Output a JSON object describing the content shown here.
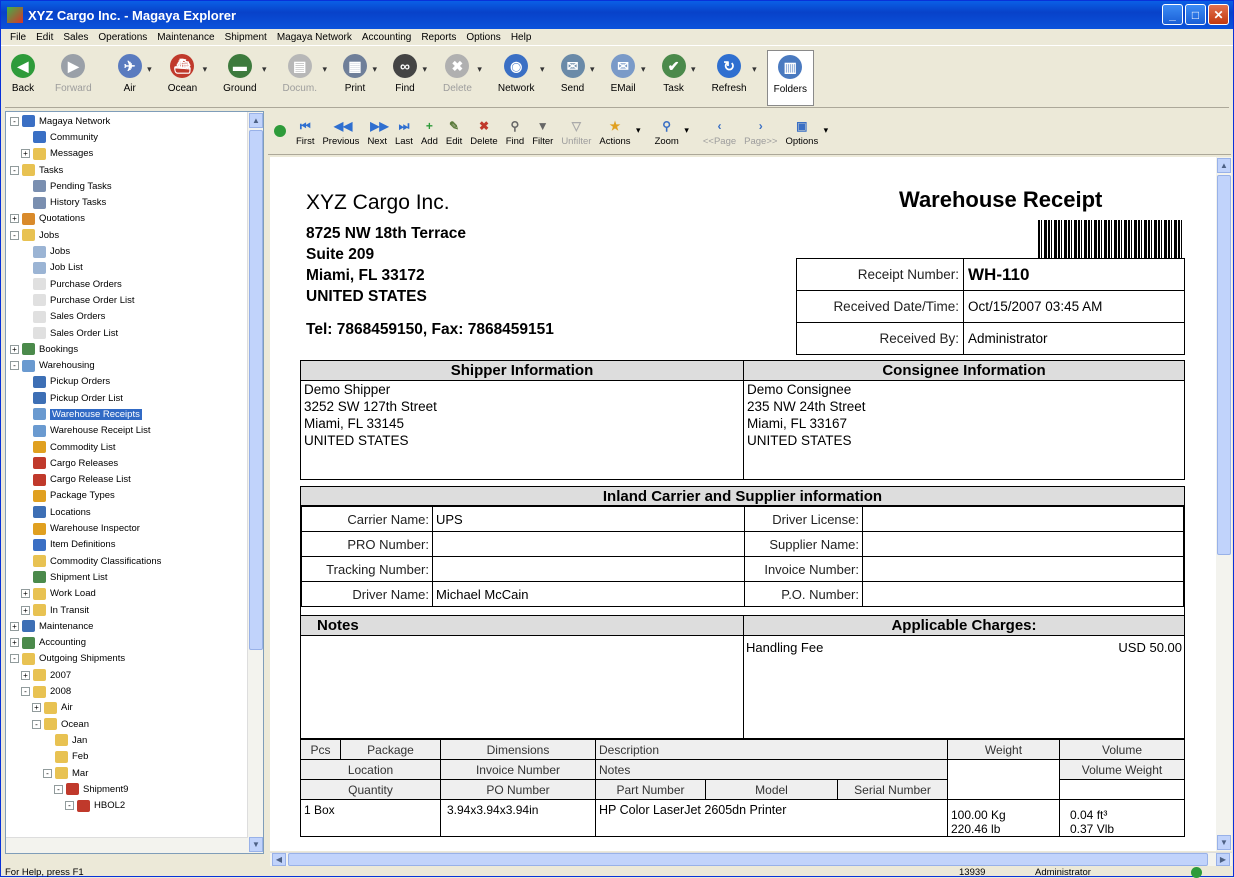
{
  "window": {
    "title": "XYZ Cargo Inc. - Magaya Explorer"
  },
  "menu": [
    "File",
    "Edit",
    "Sales",
    "Operations",
    "Maintenance",
    "Shipment",
    "Magaya Network",
    "Accounting",
    "Reports",
    "Options",
    "Help"
  ],
  "toolbar": [
    {
      "label": "Back",
      "icon": "back-arrow-icon",
      "color": "#2e9b3a",
      "disabled": false
    },
    {
      "label": "Forward",
      "icon": "forward-arrow-icon",
      "color": "#9aa0a8",
      "disabled": true
    },
    {
      "label": "Air",
      "icon": "airplane-icon",
      "color": "#5a7bbf",
      "disabled": false
    },
    {
      "label": "Ocean",
      "icon": "ship-icon",
      "color": "#c0392b",
      "disabled": false
    },
    {
      "label": "Ground",
      "icon": "truck-icon",
      "color": "#3d7a3d",
      "disabled": false
    },
    {
      "label": "Docum.",
      "icon": "document-icon",
      "color": "#b7b7b7",
      "disabled": true
    },
    {
      "label": "Print",
      "icon": "printer-icon",
      "color": "#6f7f99",
      "disabled": false
    },
    {
      "label": "Find",
      "icon": "binoculars-icon",
      "color": "#444",
      "disabled": false
    },
    {
      "label": "Delete",
      "icon": "delete-x-icon",
      "color": "#b0b0b0",
      "disabled": true
    },
    {
      "label": "Network",
      "icon": "network-globe-icon",
      "color": "#3a6fc4",
      "disabled": false
    },
    {
      "label": "Send",
      "icon": "send-icon",
      "color": "#6a8aa8",
      "disabled": false
    },
    {
      "label": "EMail",
      "icon": "email-icon",
      "color": "#7a9ac8",
      "disabled": false
    },
    {
      "label": "Task",
      "icon": "task-icon",
      "color": "#4b8a4b",
      "disabled": false
    },
    {
      "label": "Refresh",
      "icon": "refresh-icon",
      "color": "#2f6fd0",
      "disabled": false
    },
    {
      "label": "Folders",
      "icon": "folders-icon",
      "color": "#4a7ac0",
      "disabled": false
    }
  ],
  "tree": [
    {
      "label": "Magaya Network",
      "level": 0,
      "exp": "-",
      "color": "#3a6fc4"
    },
    {
      "label": "Community",
      "level": 1,
      "exp": "",
      "color": "#3a6fc4"
    },
    {
      "label": "Messages",
      "level": 1,
      "exp": "+",
      "color": "#e8c252"
    },
    {
      "label": "Tasks",
      "level": 0,
      "exp": "-",
      "color": "#e8c252"
    },
    {
      "label": "Pending Tasks",
      "level": 1,
      "exp": "",
      "color": "#7a8fb0"
    },
    {
      "label": "History Tasks",
      "level": 1,
      "exp": "",
      "color": "#7a8fb0"
    },
    {
      "label": "Quotations",
      "level": 0,
      "exp": "+",
      "color": "#d98a2b"
    },
    {
      "label": "Jobs",
      "level": 0,
      "exp": "-",
      "color": "#e8c252"
    },
    {
      "label": "Jobs",
      "level": 1,
      "exp": "",
      "color": "#9bb4d4"
    },
    {
      "label": "Job List",
      "level": 1,
      "exp": "",
      "color": "#9bb4d4"
    },
    {
      "label": "Purchase Orders",
      "level": 1,
      "exp": "",
      "color": "#e0e0e0"
    },
    {
      "label": "Purchase Order List",
      "level": 1,
      "exp": "",
      "color": "#e0e0e0"
    },
    {
      "label": "Sales Orders",
      "level": 1,
      "exp": "",
      "color": "#e0e0e0"
    },
    {
      "label": "Sales Order List",
      "level": 1,
      "exp": "",
      "color": "#e0e0e0"
    },
    {
      "label": "Bookings",
      "level": 0,
      "exp": "+",
      "color": "#4b8a4b"
    },
    {
      "label": "Warehousing",
      "level": 0,
      "exp": "-",
      "color": "#6a9ad0"
    },
    {
      "label": "Pickup Orders",
      "level": 1,
      "exp": "",
      "color": "#3d6fb5"
    },
    {
      "label": "Pickup Order List",
      "level": 1,
      "exp": "",
      "color": "#3d6fb5"
    },
    {
      "label": "Warehouse Receipts",
      "level": 1,
      "exp": "",
      "color": "#6a9ad0",
      "selected": true
    },
    {
      "label": "Warehouse Receipt List",
      "level": 1,
      "exp": "",
      "color": "#6a9ad0"
    },
    {
      "label": "Commodity List",
      "level": 1,
      "exp": "",
      "color": "#e0a020"
    },
    {
      "label": "Cargo Releases",
      "level": 1,
      "exp": "",
      "color": "#c0392b"
    },
    {
      "label": "Cargo Release List",
      "level": 1,
      "exp": "",
      "color": "#c0392b"
    },
    {
      "label": "Package Types",
      "level": 1,
      "exp": "",
      "color": "#e0a020"
    },
    {
      "label": "Locations",
      "level": 1,
      "exp": "",
      "color": "#3d6fb5"
    },
    {
      "label": "Warehouse Inspector",
      "level": 1,
      "exp": "",
      "color": "#e0a020"
    },
    {
      "label": "Item Definitions",
      "level": 1,
      "exp": "",
      "color": "#3a6fc4"
    },
    {
      "label": "Commodity Classifications",
      "level": 1,
      "exp": "",
      "color": "#e8c252"
    },
    {
      "label": "Shipment List",
      "level": 1,
      "exp": "",
      "color": "#4b8a4b"
    },
    {
      "label": "Work Load",
      "level": 1,
      "exp": "+",
      "color": "#e8c252"
    },
    {
      "label": "In Transit",
      "level": 1,
      "exp": "+",
      "color": "#e8c252"
    },
    {
      "label": "Maintenance",
      "level": 0,
      "exp": "+",
      "color": "#3d6fb5"
    },
    {
      "label": "Accounting",
      "level": 0,
      "exp": "+",
      "color": "#4b8a4b"
    },
    {
      "label": "Outgoing Shipments",
      "level": 0,
      "exp": "-",
      "color": "#e8c252"
    },
    {
      "label": "2007",
      "level": 1,
      "exp": "+",
      "color": "#e8c252"
    },
    {
      "label": "2008",
      "level": 1,
      "exp": "-",
      "color": "#e8c252"
    },
    {
      "label": "Air",
      "level": 2,
      "exp": "+",
      "color": "#e8c252"
    },
    {
      "label": "Ocean",
      "level": 2,
      "exp": "-",
      "color": "#e8c252"
    },
    {
      "label": "Jan",
      "level": 3,
      "exp": "",
      "color": "#e8c252"
    },
    {
      "label": "Feb",
      "level": 3,
      "exp": "",
      "color": "#e8c252"
    },
    {
      "label": "Mar",
      "level": 3,
      "exp": "-",
      "color": "#e8c252"
    },
    {
      "label": "Shipment9",
      "level": 4,
      "exp": "-",
      "color": "#c0392b"
    },
    {
      "label": "HBOL2",
      "level": 5,
      "exp": "-",
      "color": "#c0392b"
    }
  ],
  "nav": [
    {
      "label": "First",
      "icon": "first-record-icon",
      "glyph": "⏮",
      "color": "#2f6fd0"
    },
    {
      "label": "Previous",
      "icon": "previous-record-icon",
      "glyph": "◀◀",
      "color": "#2f6fd0"
    },
    {
      "label": "Next",
      "icon": "next-record-icon",
      "glyph": "▶▶",
      "color": "#2f6fd0"
    },
    {
      "label": "Last",
      "icon": "last-record-icon",
      "glyph": "⏭",
      "color": "#2f6fd0"
    },
    {
      "label": "Add",
      "icon": "add-icon",
      "glyph": "+",
      "color": "#2e9b3a"
    },
    {
      "label": "Edit",
      "icon": "edit-icon",
      "glyph": "✎",
      "color": "#5a7a3a"
    },
    {
      "label": "Delete",
      "icon": "delete-icon",
      "glyph": "✖",
      "color": "#c0392b"
    },
    {
      "label": "Find",
      "icon": "find-icon",
      "glyph": "⚲",
      "color": "#666"
    },
    {
      "label": "Filter",
      "icon": "filter-icon",
      "glyph": "▼",
      "color": "#666"
    },
    {
      "label": "Unfilter",
      "icon": "unfilter-icon",
      "glyph": "▽",
      "color": "#aaa",
      "disabled": true
    },
    {
      "label": "Actions",
      "icon": "actions-star-icon",
      "glyph": "★",
      "color": "#e0a020",
      "dd": true
    },
    {
      "label": "Zoom",
      "icon": "zoom-icon",
      "glyph": "⚲",
      "color": "#3a6fc4",
      "dd": true
    },
    {
      "label": "<<Page",
      "icon": "prev-page-icon",
      "glyph": "‹",
      "color": "#3a6fc4",
      "disabled": true
    },
    {
      "label": "Page>>",
      "icon": "next-page-icon",
      "glyph": "›",
      "color": "#3a6fc4",
      "disabled": true
    },
    {
      "label": "Options",
      "icon": "options-icon",
      "glyph": "▣",
      "color": "#3a6fc4",
      "dd": true
    }
  ],
  "doc": {
    "company": "XYZ Cargo Inc.",
    "address": [
      "8725 NW 18th Terrace",
      "Suite 209",
      "Miami, FL 33172",
      "UNITED STATES"
    ],
    "contact": "Tel: 7868459150,  Fax: 7868459151",
    "title": "Warehouse Receipt",
    "receipt": [
      {
        "label": "Receipt Number:",
        "value": "WH-110"
      },
      {
        "label": "Received Date/Time:",
        "value": "Oct/15/2007  03:45 AM"
      },
      {
        "label": "Received By:",
        "value": "Administrator"
      }
    ],
    "shipper": {
      "header": "Shipper Information",
      "lines": [
        "Demo Shipper",
        "3252 SW 127th Street",
        "Miami, FL 33145",
        "UNITED STATES"
      ]
    },
    "consignee": {
      "header": "Consignee Information",
      "lines": [
        "Demo Consignee",
        "235 NW 24th Street",
        "Miami, FL 33167",
        "UNITED STATES"
      ]
    },
    "carrier_header": "Inland Carrier and Supplier information",
    "carrier_rows": [
      {
        "l1": "Carrier Name:",
        "v1": "UPS",
        "l2": "Driver License:",
        "v2": ""
      },
      {
        "l1": "PRO Number:",
        "v1": "",
        "l2": "Supplier Name:",
        "v2": ""
      },
      {
        "l1": "Tracking Number:",
        "v1": "",
        "l2": "Invoice Number:",
        "v2": ""
      },
      {
        "l1": "Driver Name:",
        "v1": "Michael McCain",
        "l2": "P.O. Number:",
        "v2": ""
      }
    ],
    "notes_header": "Notes",
    "charges_header": "Applicable Charges:",
    "charge": {
      "name": "Handling Fee",
      "amount": "USD 50.00"
    },
    "items_header": {
      "r1": [
        "Pcs",
        "Package",
        "Dimensions",
        "Description",
        "Weight",
        "Volume"
      ],
      "r2": [
        "Location",
        "Invoice Number",
        "Notes",
        "Volume Weight"
      ],
      "r3": [
        "Quantity",
        "PO Number",
        "Part Number",
        "Model",
        "Serial Number"
      ]
    },
    "item": {
      "qty": "1 Box",
      "dims": "3.94x3.94x3.94in",
      "desc": "HP Color LaserJet 2605dn Printer",
      "weight1": "100.00 Kg",
      "weight2": "220.46 lb",
      "vol1": "0.04 ft³",
      "vol2": "0.37 Vlb"
    }
  },
  "status": {
    "help": "For Help, press F1",
    "num": "13939",
    "user": "Administrator"
  }
}
